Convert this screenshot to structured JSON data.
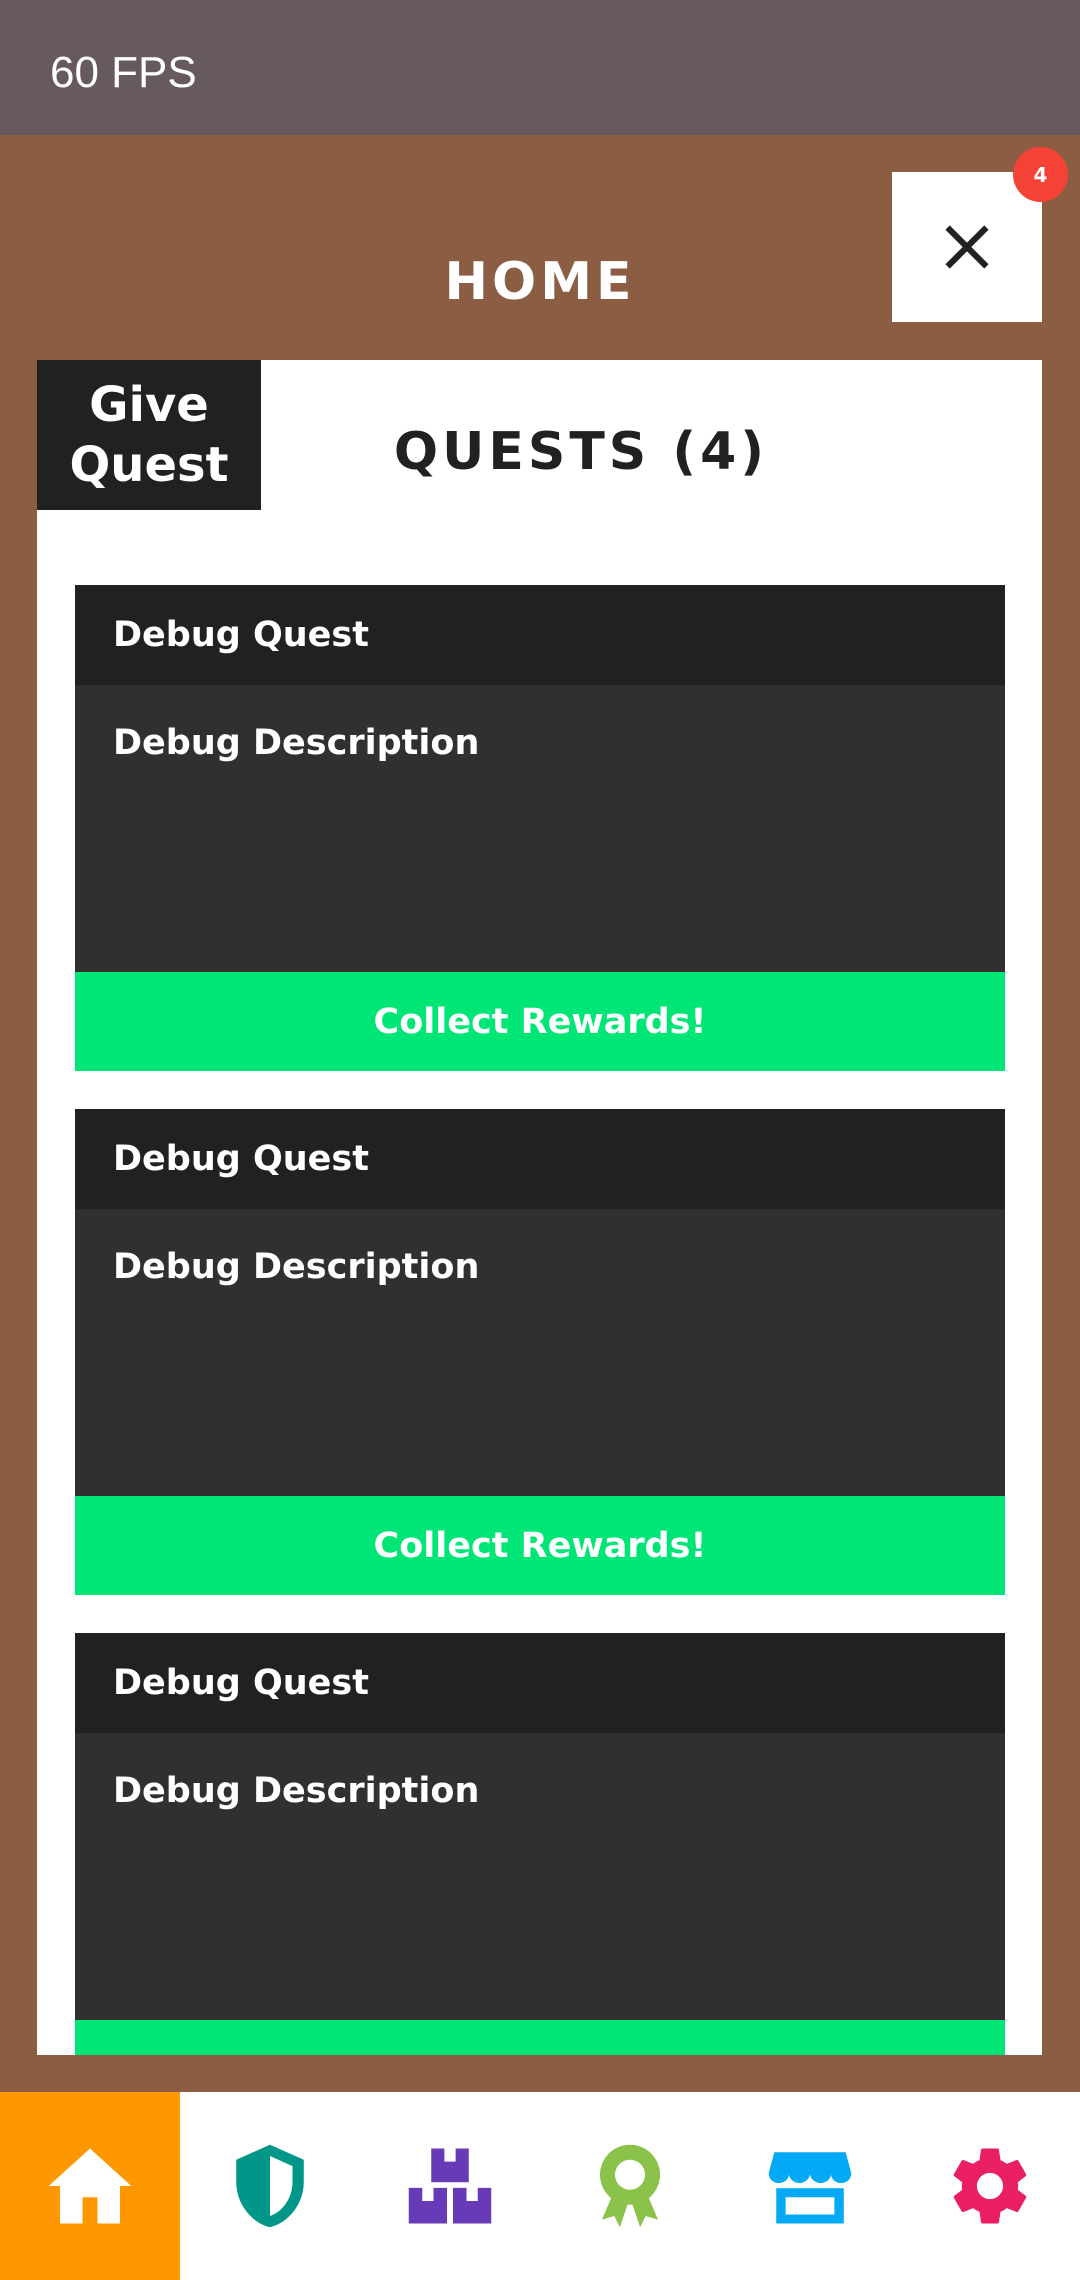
{
  "status_bar": {
    "fps": "60 FPS"
  },
  "header": {
    "title": "HOME",
    "close_icon": "close-icon",
    "notification_count": "4"
  },
  "panel": {
    "give_quest_label": "Give\nQuest",
    "heading": "QUESTS (4)",
    "quests": [
      {
        "title": "Debug Quest",
        "description": "Debug Description",
        "button_label": "Collect Rewards!"
      },
      {
        "title": "Debug Quest",
        "description": "Debug Description",
        "button_label": "Collect Rewards!"
      },
      {
        "title": "Debug Quest",
        "description": "Debug Description",
        "button_label": ""
      }
    ]
  },
  "bottom_nav": {
    "items": [
      {
        "icon": "home-icon",
        "color": "#ffffff",
        "active": true
      },
      {
        "icon": "shield-icon",
        "color": "#009688",
        "active": false
      },
      {
        "icon": "boxes-icon",
        "color": "#673ab7",
        "active": false
      },
      {
        "icon": "award-icon",
        "color": "#8bc34a",
        "active": false
      },
      {
        "icon": "store-icon",
        "color": "#03a9f4",
        "active": false
      },
      {
        "icon": "gear-icon",
        "color": "#e91e63",
        "active": false
      }
    ]
  },
  "colors": {
    "background": "#8b5e43",
    "status_bar": "#665960",
    "card_header": "#212121",
    "card_body": "#303030",
    "collect_button": "#00e676",
    "active_nav": "#ff9800",
    "badge": "#f44336"
  }
}
